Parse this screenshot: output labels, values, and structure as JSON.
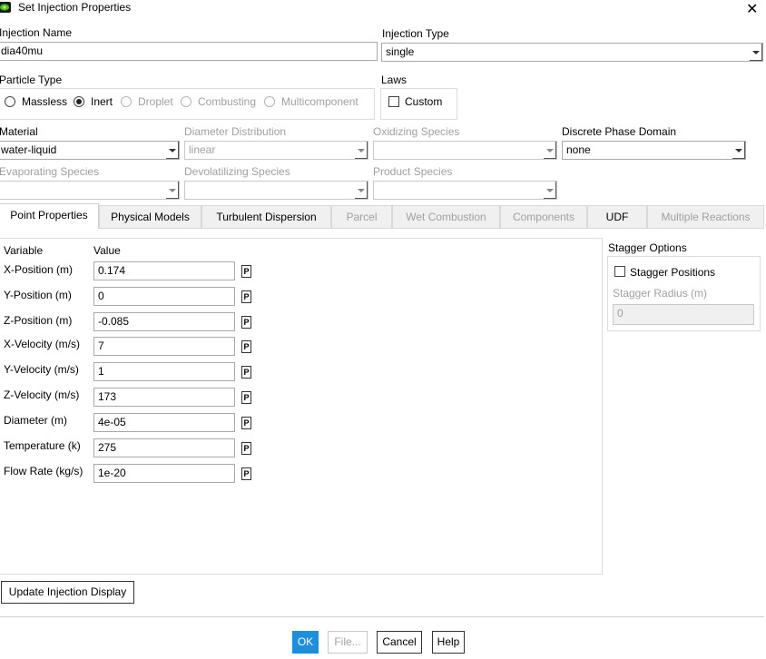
{
  "window": {
    "title": "Set Injection Properties"
  },
  "injection_name": {
    "label": "Injection Name",
    "value": "dia40mu"
  },
  "injection_type": {
    "label": "Injection Type",
    "value": "single"
  },
  "particle_type": {
    "label": "Particle Type",
    "options": [
      "Massless",
      "Inert",
      "Droplet",
      "Combusting",
      "Multicomponent"
    ],
    "selected": "Inert"
  },
  "laws": {
    "label": "Laws",
    "custom_label": "Custom"
  },
  "material": {
    "label": "Material",
    "value": "water-liquid"
  },
  "diameter_distribution": {
    "label": "Diameter Distribution",
    "value": "linear"
  },
  "oxidizing_species": {
    "label": "Oxidizing Species",
    "value": ""
  },
  "discrete_phase_domain": {
    "label": "Discrete Phase Domain",
    "value": "none"
  },
  "evaporating_species": {
    "label": "Evaporating Species",
    "value": ""
  },
  "devolatilizing_species": {
    "label": "Devolatilizing Species",
    "value": ""
  },
  "product_species": {
    "label": "Product Species",
    "value": ""
  },
  "tabs": [
    "Point Properties",
    "Physical Models",
    "Turbulent Dispersion",
    "Parcel",
    "Wet Combustion",
    "Components",
    "UDF",
    "Multiple Reactions"
  ],
  "table": {
    "col_variable": "Variable",
    "col_value": "Value",
    "param_button": "P",
    "rows": [
      {
        "label": "X-Position (m)",
        "value": "0.174"
      },
      {
        "label": "Y-Position (m)",
        "value": "0"
      },
      {
        "label": "Z-Position (m)",
        "value": "-0.085"
      },
      {
        "label": "X-Velocity (m/s)",
        "value": "7"
      },
      {
        "label": "Y-Velocity (m/s)",
        "value": "1"
      },
      {
        "label": "Z-Velocity (m/s)",
        "value": "173"
      },
      {
        "label": "Diameter (m)",
        "value": "4e-05"
      },
      {
        "label": "Temperature (k)",
        "value": "275"
      },
      {
        "label": "Flow Rate (kg/s)",
        "value": "1e-20"
      }
    ]
  },
  "stagger": {
    "title": "Stagger Options",
    "positions_label": "Stagger Positions",
    "radius_label": "Stagger Radius (m)",
    "radius_value": "0"
  },
  "buttons": {
    "update_display": "Update Injection Display",
    "ok": "OK",
    "file": "File...",
    "cancel": "Cancel",
    "help": "Help"
  },
  "colors": {
    "accent": "#1e8fdc",
    "disabled_text": "#a0a0a0"
  }
}
